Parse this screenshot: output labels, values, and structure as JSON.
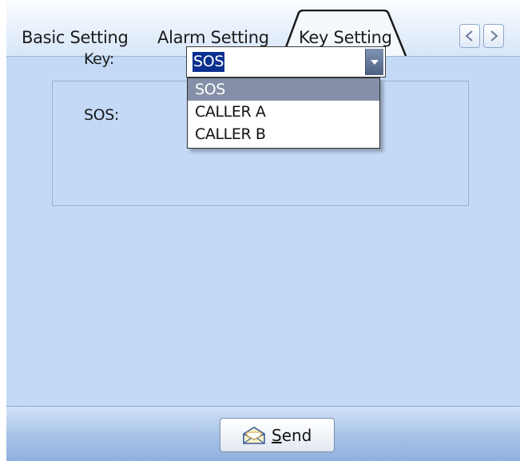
{
  "tabs": [
    {
      "label": "Basic Setting",
      "active": false
    },
    {
      "label": "Alarm Setting",
      "active": false
    },
    {
      "label": "Key Setting",
      "active": true
    }
  ],
  "scroll_buttons": {
    "left_icon": "chevron-left-icon",
    "right_icon": "chevron-right-icon"
  },
  "form": {
    "key_label": "Key:",
    "sos_label": "SOS:",
    "key_selected": "SOS",
    "key_options": [
      "SOS",
      "CALLER A",
      "CALLER B"
    ]
  },
  "footer": {
    "send_label_mnemonic": "S",
    "send_label_rest": "end",
    "send_icon": "envelope-icon"
  },
  "colors": {
    "panel_bg": "#c3d9f5",
    "selection": "#0a2f8f",
    "highlighted_option": "#8590a8"
  }
}
